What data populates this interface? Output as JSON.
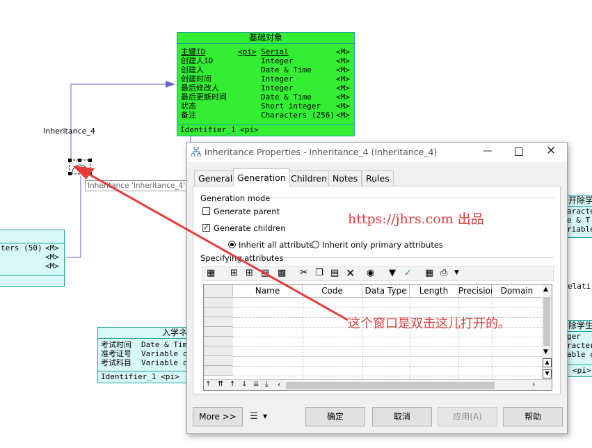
{
  "entities": {
    "base": {
      "title": "基础对象",
      "rows": [
        {
          "name": "主键ID",
          "key": "<pi>",
          "type": "Serial",
          "mand": "<M>"
        },
        {
          "name": "创建人ID",
          "key": "",
          "type": "Integer",
          "mand": "<M>"
        },
        {
          "name": "创建人",
          "key": "",
          "type": "Date & Time",
          "mand": "<M>"
        },
        {
          "name": "创建时间",
          "key": "",
          "type": "Integer",
          "mand": "<M>"
        },
        {
          "name": "最后修改人",
          "key": "",
          "type": "Integer",
          "mand": "<M>"
        },
        {
          "name": "最后更新时间",
          "key": "",
          "type": "Date & Time",
          "mand": "<M>"
        },
        {
          "name": "状态",
          "key": "",
          "type": "Short integer",
          "mand": "<M>"
        },
        {
          "name": "备注",
          "key": "",
          "type": "Characters (256)",
          "mand": "<M>"
        }
      ],
      "identifier": "Identifier_1  <pi>"
    },
    "left": {
      "rows": [
        {
          "text": "ters (50)",
          "mand": "<M>"
        },
        {
          "text": "",
          "mand": "<M>"
        },
        {
          "text": "",
          "mand": "<M>"
        }
      ]
    },
    "exam": {
      "title": "入学ネ",
      "rows": [
        {
          "name": "考试时间",
          "type": "Date & Time"
        },
        {
          "name": "准考证号",
          "type": "Variable ch"
        },
        {
          "name": "考试科目",
          "type": "Variable ch"
        }
      ],
      "identifier": "Identifier_1  <pi>"
    },
    "right_top": {
      "title": "开除学",
      "rows": [
        "aracte",
        "e & T",
        "riable"
      ]
    },
    "right_bottom": {
      "title": "除学生",
      "rows": [
        "ger",
        "racters",
        "able c"
      ],
      "identifier": "<pi>"
    }
  },
  "diagram": {
    "inheritance_label": "Inheritance_4",
    "tooltip": "Inheritance 'Inheritance_4'",
    "relation_fragment": "elati"
  },
  "annotations": {
    "watermark": "https://jhrs.com 出品",
    "note": "这个窗口是双击这儿打开的。"
  },
  "dialog": {
    "title": "Inheritance Properties - Inheritance_4 (Inheritance_4)",
    "tabs": [
      "General",
      "Generation",
      "Children",
      "Notes",
      "Rules"
    ],
    "active_tab": "Generation",
    "generation_mode_label": "Generation mode",
    "generate_parent_label": "Generate parent",
    "generate_parent_checked": false,
    "generate_children_label": "Generate children",
    "generate_children_checked": true,
    "inherit_all_label": "Inherit all attributes",
    "inherit_primary_label": "Inherit only primary attributes",
    "specifying_label": "Specifying attributes",
    "columns": [
      "Name",
      "Code",
      "Data Type",
      "Length",
      "Precision",
      "Domain"
    ],
    "buttons": {
      "more": "More >>",
      "ok": "确定",
      "cancel": "取消",
      "apply": "应用(A)",
      "help": "帮助"
    }
  },
  "colors": {
    "entity_green": "#33ee33",
    "entity_cyan": "#d8f8f8",
    "arrow_red": "#e43b3b",
    "watermark_red": "#d94040"
  }
}
